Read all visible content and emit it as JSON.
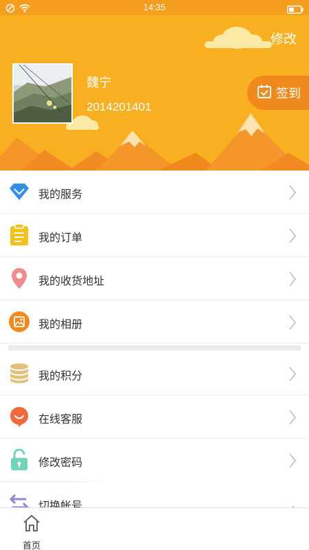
{
  "status_bar": {
    "time": "14:35"
  },
  "profile": {
    "edit_label": "修改",
    "name": "魏宁",
    "id": "2014201401",
    "checkin_label": "签到"
  },
  "menu": {
    "group1": [
      {
        "label": "我的服务",
        "icon": "diamond-icon"
      },
      {
        "label": "我的订单",
        "icon": "clipboard-icon"
      },
      {
        "label": "我的收货地址",
        "icon": "location-pin-icon"
      },
      {
        "label": "我的相册",
        "icon": "photo-icon"
      }
    ],
    "group2": [
      {
        "label": "我的积分",
        "icon": "coins-icon"
      },
      {
        "label": "在线客服",
        "icon": "chat-bubble-icon"
      },
      {
        "label": "修改密码",
        "icon": "unlock-icon"
      },
      {
        "label": "切换帐号",
        "icon": "switch-arrows-icon"
      }
    ]
  },
  "tabbar": {
    "home_label": "首页"
  },
  "colors": {
    "header": "#f9b020",
    "status_bar": "#f59d1c",
    "checkin_bg": "#f08a1c",
    "diamond": "#2f8fe6",
    "clipboard": "#f2c21b",
    "pin": "#f08b8e",
    "photo": "#f08a1c",
    "coins": "#e2c27a",
    "chat": "#f06a3c",
    "lock": "#6fd6b7",
    "switch": "#8f86d8"
  }
}
